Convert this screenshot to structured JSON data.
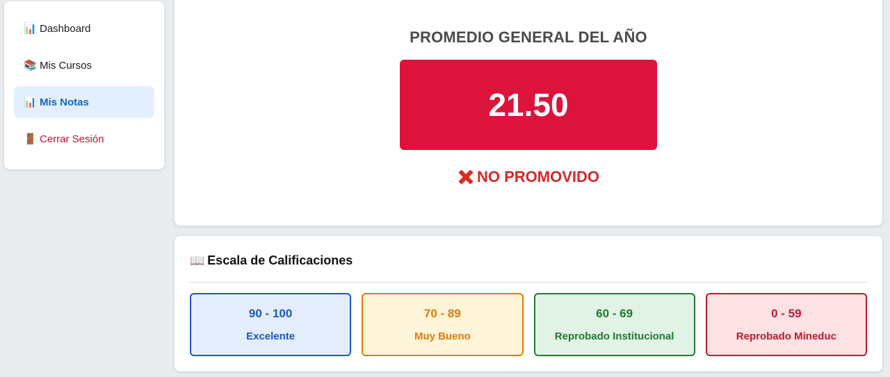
{
  "sidebar": {
    "items": [
      {
        "icon": "📊",
        "label": "Dashboard"
      },
      {
        "icon": "📚",
        "label": "Mis Cursos"
      },
      {
        "icon": "📊",
        "label": "Mis Notas",
        "active": true
      },
      {
        "icon": "🚪",
        "label": "Cerrar Sesión"
      }
    ]
  },
  "average": {
    "title": "PROMEDIO GENERAL DEL AÑO",
    "value": "21.50",
    "status_icon": "cross-mark-icon",
    "status": "NO PROMOVIDO",
    "box_color": "#dc143c"
  },
  "scale": {
    "icon": "📖",
    "title": "Escala de Calificaciones",
    "grades": [
      {
        "range": "90 - 100",
        "label": "Excelente",
        "color": "#1a56c8",
        "bg": "#e4edfd"
      },
      {
        "range": "70 - 89",
        "label": "Muy Bueno",
        "color": "#e07b00",
        "bg": "#fdf4d9"
      },
      {
        "range": "60 - 69",
        "label": "Reprobado Institucional",
        "color": "#1e7a2e",
        "bg": "#e1f3e5"
      },
      {
        "range": "0 - 59",
        "label": "Reprobado Mineduc",
        "color": "#c0182a",
        "bg": "#fde2e4"
      }
    ]
  }
}
